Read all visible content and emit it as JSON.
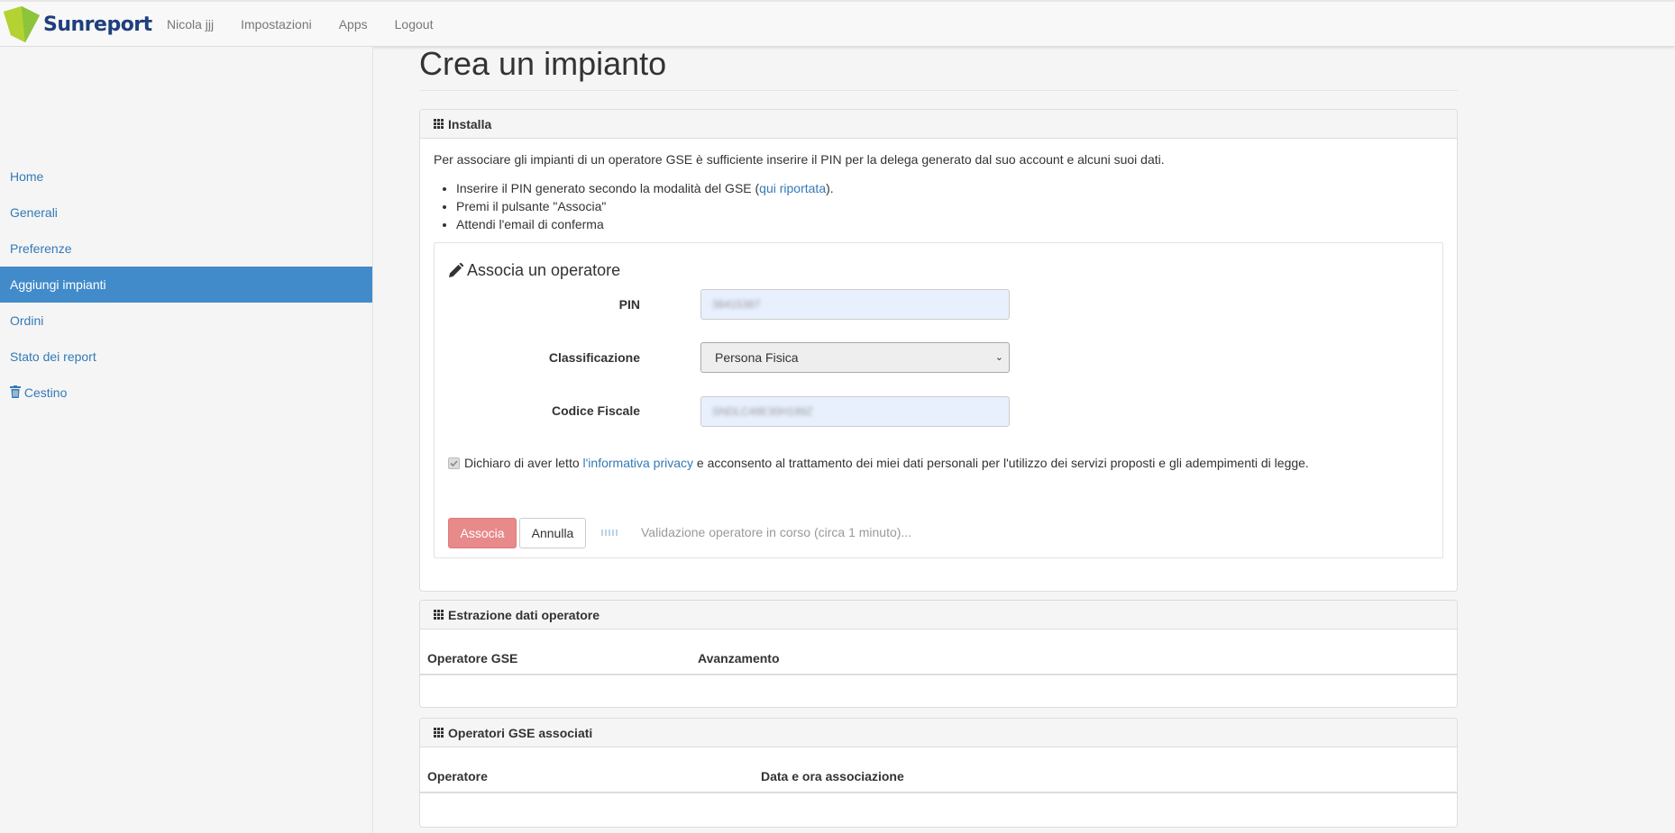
{
  "header": {
    "brand": "Sunreport",
    "brand_colors": {
      "leaf_light": "#b4d232",
      "leaf_dark": "#6aa62d",
      "text": "#1f3f7d"
    },
    "nav": [
      "Nicola jjj",
      "Impostazioni",
      "Apps",
      "Logout"
    ]
  },
  "sidebar": {
    "items": [
      {
        "label": "Home",
        "active": false
      },
      {
        "label": "Generali",
        "active": false
      },
      {
        "label": "Preferenze",
        "active": false
      },
      {
        "label": "Aggiungi impianti",
        "active": true
      },
      {
        "label": "Ordini",
        "active": false
      },
      {
        "label": "Stato dei report",
        "active": false
      },
      {
        "label": "Cestino",
        "active": false,
        "icon": "trash-icon"
      }
    ]
  },
  "page": {
    "title": "Crea un impianto"
  },
  "install_panel": {
    "heading": "Installa",
    "intro": "Per associare gli impianti di un operatore GSE è sufficiente inserire il PIN per la delega generato dal suo account e alcuni suoi dati.",
    "steps": {
      "s1_before": "Inserire il PIN generato secondo la modalità del GSE (",
      "s1_link": "qui riportata",
      "s1_after": ").",
      "s2": "Premi il pulsante \"Associa\"",
      "s3": "Attendi l'email di conferma"
    },
    "form": {
      "title": "Associa un operatore",
      "pin_label": "PIN",
      "pin_value": "38415387",
      "class_label": "Classificazione",
      "class_value": "Persona Fisica",
      "cf_label": "Codice Fiscale",
      "cf_value": "SNDLC48E30H199Z",
      "privacy_before": "Dichiaro di aver letto ",
      "privacy_link": "l'informativa privacy",
      "privacy_after": " e acconsento al trattamento dei miei dati personali per l'utilizzo dei servizi proposti e gli adempimenti di legge.",
      "privacy_checked": true,
      "submit": "Associa",
      "cancel": "Annulla",
      "status": "Validazione operatore in corso (circa 1 minuto)..."
    }
  },
  "extraction_panel": {
    "heading": "Estrazione dati operatore",
    "columns": [
      "Operatore GSE",
      "Avanzamento"
    ]
  },
  "associated_panel": {
    "heading": "Operatori GSE associati",
    "columns": [
      "Operatore",
      "Data e ora associazione"
    ]
  }
}
